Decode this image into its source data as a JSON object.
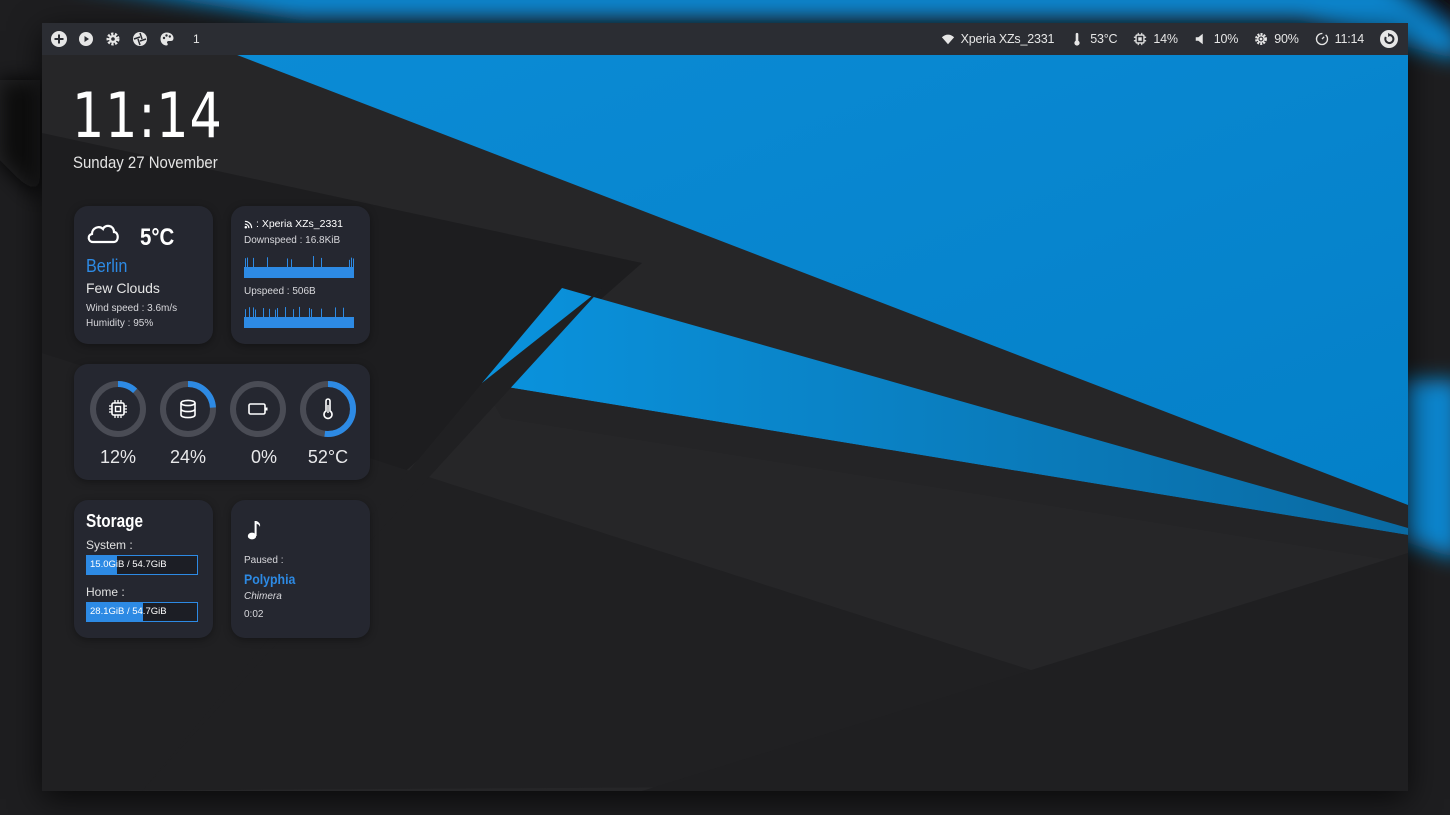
{
  "colors": {
    "accent": "#2d8ae4",
    "wallpaper_blue": "#0387d0",
    "panel_bg": "#252730",
    "topbar_bg": "#2b2d33"
  },
  "topbar": {
    "left_icons": [
      "add-icon",
      "play-icon",
      "settings-icon",
      "aperture-icon",
      "palette-icon"
    ],
    "workspace": "1",
    "wifi": {
      "icon": "wifi-icon",
      "label": "Xperia XZs_2331"
    },
    "temp": {
      "icon": "thermometer-icon",
      "label": "53°C"
    },
    "cpu": {
      "icon": "cpu-icon",
      "label": "14%"
    },
    "volume": {
      "icon": "volume-icon",
      "label": "10%"
    },
    "brightness": {
      "icon": "brightness-icon",
      "label": "90%"
    },
    "clock": {
      "icon": "clock-icon",
      "label": "11:14"
    },
    "power_icon": "power-icon"
  },
  "clock": {
    "time": "11:14",
    "date": "Sunday 27 November"
  },
  "weather": {
    "icon": "cloud-icon",
    "temp": "5°C",
    "city": "Berlin",
    "desc": "Few Clouds",
    "wind": "Wind speed : 3.6m/s",
    "humidity": "Humidity : 95%"
  },
  "network": {
    "ssid": ": Xperia XZs_2331",
    "down": "Downspeed : 16.8KiB",
    "up": "Upspeed : 506B"
  },
  "gauges": [
    {
      "icon": "cpu-icon",
      "value": "12%",
      "fraction": 0.12
    },
    {
      "icon": "database-icon",
      "value": "24%",
      "fraction": 0.24
    },
    {
      "icon": "battery-icon",
      "value": "0%",
      "fraction": 0.0
    },
    {
      "icon": "thermometer-icon",
      "value": "52°C",
      "fraction": 0.52
    }
  ],
  "storage": {
    "title": "Storage",
    "system_label": "System :",
    "system_text": "15.0GiB / 54.7GiB",
    "system_fraction": 0.27,
    "home_label": "Home :",
    "home_text": "28.1GiB / 54.7GiB",
    "home_fraction": 0.51
  },
  "music": {
    "icon": "music-note-icon",
    "status": "Paused :",
    "artist": "Polyphia",
    "album": "Chimera",
    "time": "0:02"
  }
}
